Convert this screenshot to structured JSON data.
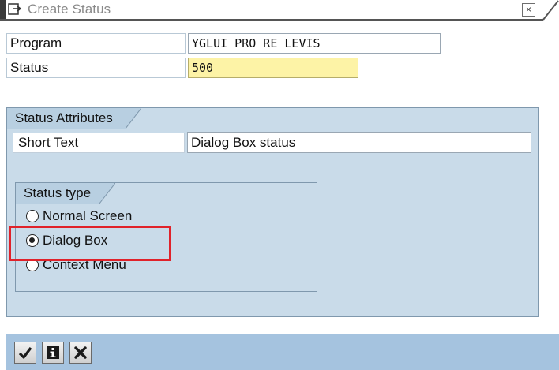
{
  "window": {
    "title": "Create Status",
    "close_symbol": "×",
    "icons": {
      "title": "create-window-icon",
      "close": "close-icon"
    }
  },
  "header": {
    "program_label": "Program",
    "program_value": "YGLUI_PRO_RE_LEVIS",
    "status_label": "Status",
    "status_value": "500"
  },
  "attributes": {
    "group_title": "Status Attributes",
    "short_text_label": "Short Text",
    "short_text_value": "Dialog Box status"
  },
  "status_type": {
    "group_title": "Status type",
    "options": [
      {
        "label": "Normal Screen",
        "selected": false
      },
      {
        "label": "Dialog Box",
        "selected": true
      },
      {
        "label": "Context Menu",
        "selected": false
      }
    ]
  },
  "toolbar": {
    "buttons": [
      {
        "icon": "checkmark-icon"
      },
      {
        "icon": "info-icon"
      },
      {
        "icon": "cancel-x-icon"
      }
    ]
  },
  "colors": {
    "group_background": "#c9dbe9",
    "toolbar_background": "#a5c3df",
    "required_field": "#fdf3a6",
    "highlight": "#e0222a"
  }
}
